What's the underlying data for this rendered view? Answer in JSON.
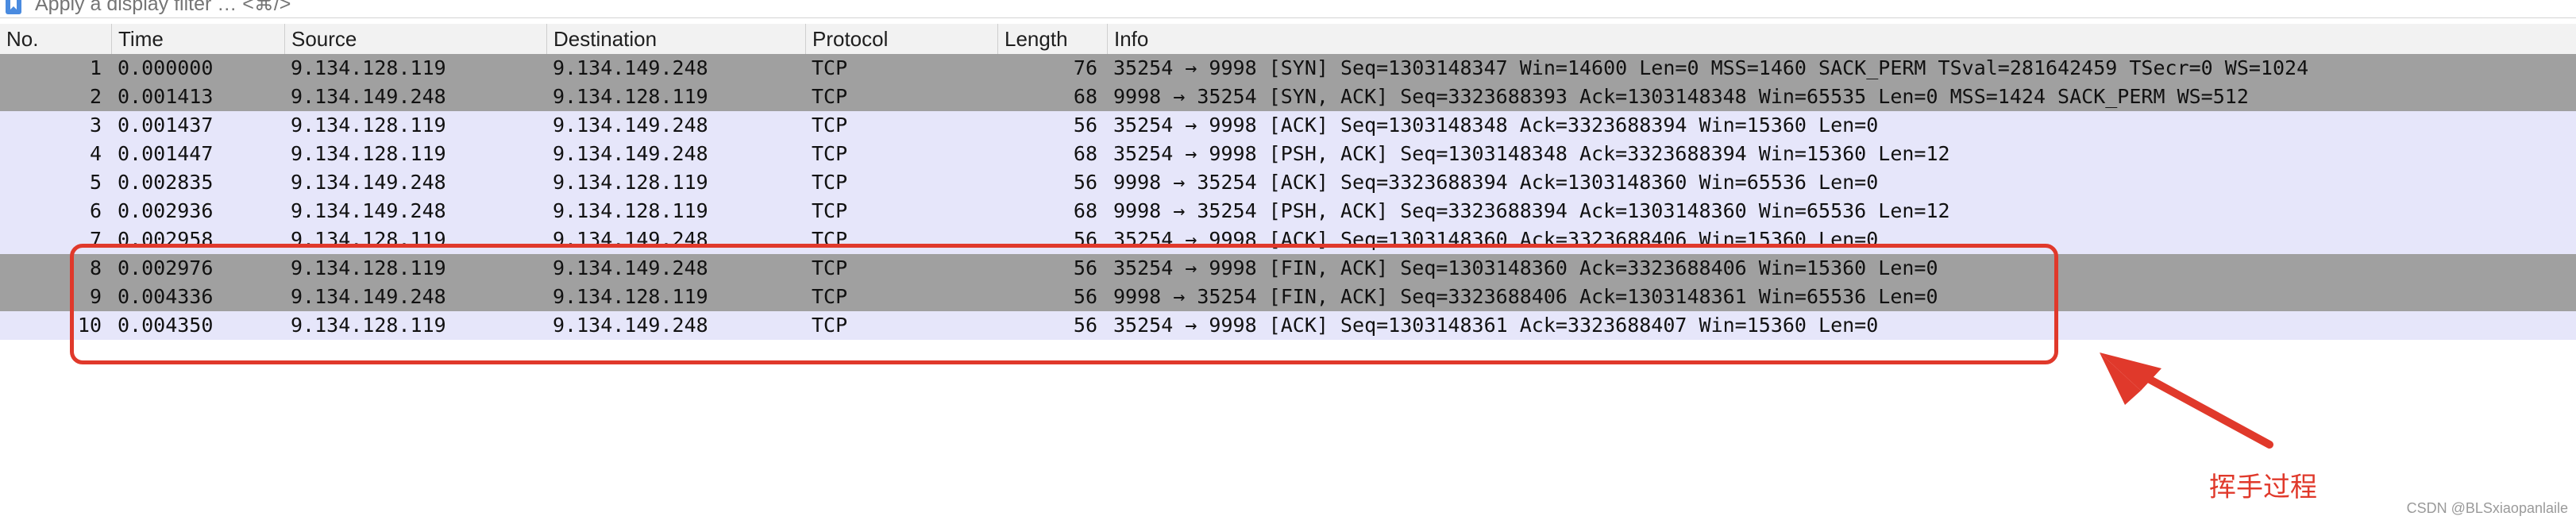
{
  "filter": {
    "placeholder": "Apply a display filter … <⌘/>",
    "bookmark_icon": "bookmark-icon"
  },
  "columns": [
    "No.",
    "Time",
    "Source",
    "Destination",
    "Protocol",
    "Length",
    "Info"
  ],
  "packets": [
    {
      "no": "1",
      "time": "0.000000",
      "source": "9.134.128.119",
      "destination": "9.134.149.248",
      "protocol": "TCP",
      "length": "76",
      "info": "35254 → 9998 [SYN] Seq=1303148347 Win=14600 Len=0 MSS=1460 SACK_PERM TSval=281642459 TSecr=0 WS=1024",
      "shade": "gray"
    },
    {
      "no": "2",
      "time": "0.001413",
      "source": "9.134.149.248",
      "destination": "9.134.128.119",
      "protocol": "TCP",
      "length": "68",
      "info": "9998 → 35254 [SYN, ACK] Seq=3323688393 Ack=1303148348 Win=65535 Len=0 MSS=1424 SACK_PERM WS=512",
      "shade": "gray"
    },
    {
      "no": "3",
      "time": "0.001437",
      "source": "9.134.128.119",
      "destination": "9.134.149.248",
      "protocol": "TCP",
      "length": "56",
      "info": "35254 → 9998 [ACK] Seq=1303148348 Ack=3323688394 Win=15360 Len=0",
      "shade": "lav"
    },
    {
      "no": "4",
      "time": "0.001447",
      "source": "9.134.128.119",
      "destination": "9.134.149.248",
      "protocol": "TCP",
      "length": "68",
      "info": "35254 → 9998 [PSH, ACK] Seq=1303148348 Ack=3323688394 Win=15360 Len=12",
      "shade": "lav"
    },
    {
      "no": "5",
      "time": "0.002835",
      "source": "9.134.149.248",
      "destination": "9.134.128.119",
      "protocol": "TCP",
      "length": "56",
      "info": "9998 → 35254 [ACK] Seq=3323688394 Ack=1303148360 Win=65536 Len=0",
      "shade": "lav"
    },
    {
      "no": "6",
      "time": "0.002936",
      "source": "9.134.149.248",
      "destination": "9.134.128.119",
      "protocol": "TCP",
      "length": "68",
      "info": "9998 → 35254 [PSH, ACK] Seq=3323688394 Ack=1303148360 Win=65536 Len=12",
      "shade": "lav"
    },
    {
      "no": "7",
      "time": "0.002958",
      "source": "9.134.128.119",
      "destination": "9.134.149.248",
      "protocol": "TCP",
      "length": "56",
      "info": "35254 → 9998 [ACK] Seq=1303148360 Ack=3323688406 Win=15360 Len=0",
      "shade": "lav"
    },
    {
      "no": "8",
      "time": "0.002976",
      "source": "9.134.128.119",
      "destination": "9.134.149.248",
      "protocol": "TCP",
      "length": "56",
      "info": "35254 → 9998 [FIN, ACK] Seq=1303148360 Ack=3323688406 Win=15360 Len=0",
      "shade": "gray"
    },
    {
      "no": "9",
      "time": "0.004336",
      "source": "9.134.149.248",
      "destination": "9.134.128.119",
      "protocol": "TCP",
      "length": "56",
      "info": "9998 → 35254 [FIN, ACK] Seq=3323688406 Ack=1303148361 Win=65536 Len=0",
      "shade": "gray"
    },
    {
      "no": "10",
      "time": "0.004350",
      "source": "9.134.128.119",
      "destination": "9.134.149.248",
      "protocol": "TCP",
      "length": "56",
      "info": "35254 → 9998 [ACK] Seq=1303148361 Ack=3323688407 Win=15360 Len=0",
      "shade": "lav"
    }
  ],
  "colors": {
    "row_gray": "#a0a0a0",
    "row_lavender": "#e6e6fa",
    "annotation": "#e0392b"
  },
  "annotation": {
    "label": "挥手过程"
  },
  "watermark": "CSDN @BLSxiaopanlaile"
}
